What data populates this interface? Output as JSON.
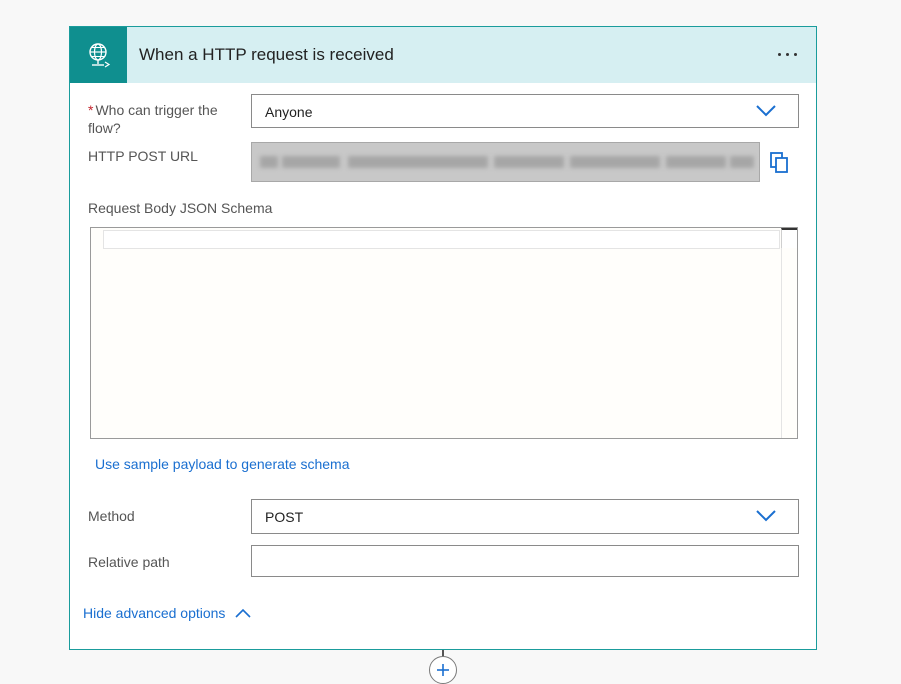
{
  "trigger": {
    "title": "When a HTTP request is received",
    "icon": "globe-request-icon",
    "more_icon": "more-options-icon",
    "accent_color": "#0f8f8f",
    "header_bg": "#d6eff2"
  },
  "fields": {
    "who_label": "Who can trigger the flow?",
    "who_required_marker": "*",
    "who_value": "Anyone",
    "url_label": "HTTP POST URL",
    "url_value": "",
    "schema_label": "Request Body JSON Schema",
    "schema_value": "",
    "sample_payload_link": "Use sample payload to generate schema",
    "method_label": "Method",
    "method_value": "POST",
    "path_label": "Relative path",
    "path_value": "",
    "advanced_link": "Hide advanced options"
  },
  "link_color": "#1a6fd0"
}
